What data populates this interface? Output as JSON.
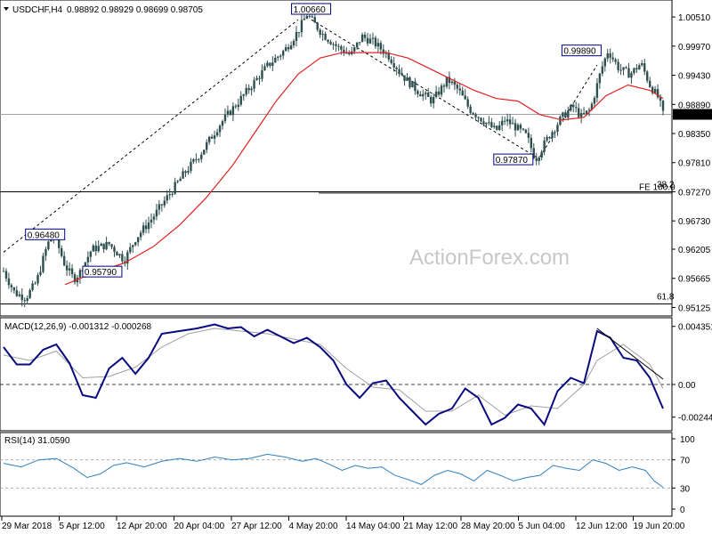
{
  "header": {
    "symbol": "USDCHF,H4",
    "ohlc": "0.98892 0.98929 0.98699 0.98705"
  },
  "watermark": "ActionForex.com",
  "colors": {
    "candle": "#2f4f4f",
    "ma": "#e02020",
    "macd_line": "#0a0a80",
    "signal_line": "#a0a0a0",
    "rsi": "#2f7fbf",
    "level_line": "#000000",
    "trendline": "#000000"
  },
  "chart_data": [
    {
      "type": "candlestick",
      "title": "USDCHF,H4",
      "y_ticks": [
        "1.00510",
        "0.99970",
        "0.99430",
        "0.98890",
        "0.98350",
        "0.97810",
        "0.97270",
        "0.96730",
        "0.96205",
        "0.95665",
        "0.95125"
      ],
      "ylim": [
        0.9505,
        1.0066
      ],
      "current_price": "0.98705",
      "x_ticks": [
        "29 Mar 2018",
        "5 Apr 12:00",
        "12 Apr 20:00",
        "20 Apr 04:00",
        "27 Apr 12:00",
        "4 May 20:00",
        "14 May 04:00",
        "21 May 12:00",
        "28 May 20:00",
        "5 Jun 04:00",
        "12 Jun 12:00",
        "19 Jun 20:00"
      ],
      "price_path": [
        [
          0,
          0.958
        ],
        [
          5,
          0.954
        ],
        [
          10,
          0.953
        ],
        [
          15,
          0.956
        ],
        [
          20,
          0.963
        ],
        [
          23,
          0.9648
        ],
        [
          28,
          0.959
        ],
        [
          32,
          0.9565
        ],
        [
          35,
          0.9579
        ],
        [
          40,
          0.962
        ],
        [
          48,
          0.963
        ],
        [
          55,
          0.96
        ],
        [
          60,
          0.964
        ],
        [
          68,
          0.968
        ],
        [
          75,
          0.972
        ],
        [
          82,
          0.976
        ],
        [
          90,
          0.98
        ],
        [
          98,
          0.985
        ],
        [
          106,
          0.989
        ],
        [
          114,
          0.993
        ],
        [
          120,
          0.996
        ],
        [
          128,
          0.999
        ],
        [
          134,
          1.0025
        ],
        [
          138,
          1.0056
        ],
        [
          145,
          1.002
        ],
        [
          152,
          0.9995
        ],
        [
          158,
          0.998
        ],
        [
          163,
          1.0015
        ],
        [
          168,
          1.0005
        ],
        [
          175,
          0.998
        ],
        [
          182,
          0.994
        ],
        [
          188,
          0.9915
        ],
        [
          195,
          0.9895
        ],
        [
          202,
          0.9935
        ],
        [
          207,
          0.9915
        ],
        [
          212,
          0.988
        ],
        [
          218,
          0.986
        ],
        [
          224,
          0.984
        ],
        [
          228,
          0.986
        ],
        [
          232,
          0.985
        ],
        [
          238,
          0.983
        ],
        [
          242,
          0.9787
        ],
        [
          248,
          0.983
        ],
        [
          254,
          0.9865
        ],
        [
          259,
          0.9885
        ],
        [
          263,
          0.9865
        ],
        [
          267,
          0.988
        ],
        [
          272,
          0.9955
        ],
        [
          275,
          0.9989
        ],
        [
          280,
          0.9955
        ],
        [
          285,
          0.9945
        ],
        [
          290,
          0.9965
        ],
        [
          294,
          0.9925
        ],
        [
          298,
          0.99
        ],
        [
          300,
          0.98705
        ]
      ],
      "ma_path": [
        [
          28,
          0.9555
        ],
        [
          40,
          0.9575
        ],
        [
          55,
          0.9595
        ],
        [
          68,
          0.9625
        ],
        [
          80,
          0.9665
        ],
        [
          92,
          0.9715
        ],
        [
          104,
          0.9775
        ],
        [
          114,
          0.9835
        ],
        [
          124,
          0.9895
        ],
        [
          134,
          0.9945
        ],
        [
          144,
          0.9975
        ],
        [
          154,
          0.9985
        ],
        [
          164,
          0.9985
        ],
        [
          174,
          0.9985
        ],
        [
          184,
          0.9975
        ],
        [
          194,
          0.9955
        ],
        [
          204,
          0.9935
        ],
        [
          214,
          0.9915
        ],
        [
          224,
          0.99
        ],
        [
          234,
          0.9895
        ],
        [
          244,
          0.987
        ],
        [
          254,
          0.986
        ],
        [
          264,
          0.9865
        ],
        [
          274,
          0.9905
        ],
        [
          284,
          0.9925
        ],
        [
          294,
          0.9915
        ],
        [
          300,
          0.99
        ]
      ],
      "labels": [
        {
          "text": "1.00660",
          "t": 131,
          "price": 1.0066
        },
        {
          "text": "0.99890",
          "t": 254,
          "price": 0.9989
        },
        {
          "text": "0.97870",
          "t": 223,
          "price": 0.9787
        },
        {
          "text": "0.96480",
          "t": 10,
          "price": 0.9648
        },
        {
          "text": "0.95790",
          "t": 36,
          "price": 0.9579
        }
      ],
      "level_texts": {
        "fe": "FE 100.0",
        "fe2": "38.2",
        "fib": "61.8"
      },
      "levels": [
        0.9727,
        0.9519
      ]
    },
    {
      "type": "line",
      "title": "MACD(12,26,9)",
      "legend": "MACD(12,26,9) -0.001312 -0.000268",
      "y_ticks": [
        "0.004351",
        "0.00",
        "-0.002448"
      ],
      "ylim": [
        -0.0032,
        0.0048
      ],
      "macd_path": [
        [
          0,
          0.0028
        ],
        [
          6,
          0.0015
        ],
        [
          12,
          0.0015
        ],
        [
          18,
          0.0026
        ],
        [
          24,
          0.003
        ],
        [
          30,
          0.0016
        ],
        [
          36,
          -0.0008
        ],
        [
          42,
          -0.001
        ],
        [
          48,
          0.0012
        ],
        [
          54,
          0.002
        ],
        [
          60,
          0.0008
        ],
        [
          66,
          0.002
        ],
        [
          72,
          0.0038
        ],
        [
          80,
          0.004
        ],
        [
          88,
          0.0042
        ],
        [
          96,
          0.0045
        ],
        [
          102,
          0.0042
        ],
        [
          108,
          0.0043
        ],
        [
          114,
          0.0036
        ],
        [
          120,
          0.0041
        ],
        [
          126,
          0.0036
        ],
        [
          132,
          0.0031
        ],
        [
          138,
          0.0035
        ],
        [
          144,
          0.0028
        ],
        [
          150,
          0.0018
        ],
        [
          156,
          0.0
        ],
        [
          162,
          -0.001
        ],
        [
          168,
          0.0001
        ],
        [
          174,
          0.0003
        ],
        [
          180,
          -0.001
        ],
        [
          186,
          -0.002
        ],
        [
          192,
          -0.003
        ],
        [
          198,
          -0.0022
        ],
        [
          204,
          -0.0018
        ],
        [
          210,
          -0.0003
        ],
        [
          216,
          -0.001
        ],
        [
          222,
          -0.003
        ],
        [
          228,
          -0.0025
        ],
        [
          234,
          -0.0015
        ],
        [
          240,
          -0.0018
        ],
        [
          246,
          -0.003
        ],
        [
          252,
          -0.0005
        ],
        [
          258,
          0.0005
        ],
        [
          264,
          0.0001
        ],
        [
          270,
          0.004
        ],
        [
          276,
          0.0035
        ],
        [
          282,
          0.002
        ],
        [
          288,
          0.0018
        ],
        [
          294,
          0.0005
        ],
        [
          300,
          -0.0018
        ]
      ],
      "signal_path": [
        [
          0,
          0.0022
        ],
        [
          12,
          0.0018
        ],
        [
          24,
          0.0025
        ],
        [
          36,
          0.0005
        ],
        [
          48,
          0.0006
        ],
        [
          60,
          0.0013
        ],
        [
          72,
          0.0028
        ],
        [
          84,
          0.0038
        ],
        [
          96,
          0.0042
        ],
        [
          108,
          0.004
        ],
        [
          120,
          0.0038
        ],
        [
          132,
          0.0034
        ],
        [
          144,
          0.003
        ],
        [
          156,
          0.0012
        ],
        [
          168,
          -0.0002
        ],
        [
          180,
          -0.0004
        ],
        [
          192,
          -0.002
        ],
        [
          204,
          -0.002
        ],
        [
          216,
          -0.0008
        ],
        [
          228,
          -0.0023
        ],
        [
          240,
          -0.0016
        ],
        [
          252,
          -0.0018
        ],
        [
          264,
          0.0
        ],
        [
          270,
          0.0018
        ],
        [
          282,
          0.003
        ],
        [
          294,
          0.0015
        ],
        [
          300,
          -0.0003
        ]
      ]
    },
    {
      "type": "line",
      "title": "RSI(14)",
      "legend": "RSI(14) 31.0590",
      "y_ticks": [
        "100",
        "70",
        "30",
        "0"
      ],
      "ylim": [
        0,
        100
      ],
      "levels": [
        70,
        30
      ],
      "rsi_path": [
        [
          0,
          65
        ],
        [
          8,
          60
        ],
        [
          16,
          70
        ],
        [
          24,
          72
        ],
        [
          32,
          58
        ],
        [
          38,
          45
        ],
        [
          44,
          50
        ],
        [
          50,
          62
        ],
        [
          56,
          66
        ],
        [
          64,
          60
        ],
        [
          72,
          68
        ],
        [
          80,
          72
        ],
        [
          88,
          68
        ],
        [
          96,
          74
        ],
        [
          104,
          70
        ],
        [
          112,
          72
        ],
        [
          120,
          78
        ],
        [
          128,
          74
        ],
        [
          136,
          68
        ],
        [
          142,
          72
        ],
        [
          148,
          64
        ],
        [
          154,
          55
        ],
        [
          160,
          62
        ],
        [
          166,
          58
        ],
        [
          172,
          60
        ],
        [
          178,
          48
        ],
        [
          184,
          42
        ],
        [
          190,
          35
        ],
        [
          196,
          48
        ],
        [
          202,
          55
        ],
        [
          208,
          50
        ],
        [
          214,
          40
        ],
        [
          220,
          55
        ],
        [
          226,
          48
        ],
        [
          232,
          40
        ],
        [
          238,
          45
        ],
        [
          244,
          48
        ],
        [
          250,
          62
        ],
        [
          256,
          58
        ],
        [
          262,
          55
        ],
        [
          268,
          70
        ],
        [
          274,
          65
        ],
        [
          280,
          55
        ],
        [
          286,
          60
        ],
        [
          292,
          55
        ],
        [
          296,
          40
        ],
        [
          300,
          31
        ]
      ]
    }
  ]
}
